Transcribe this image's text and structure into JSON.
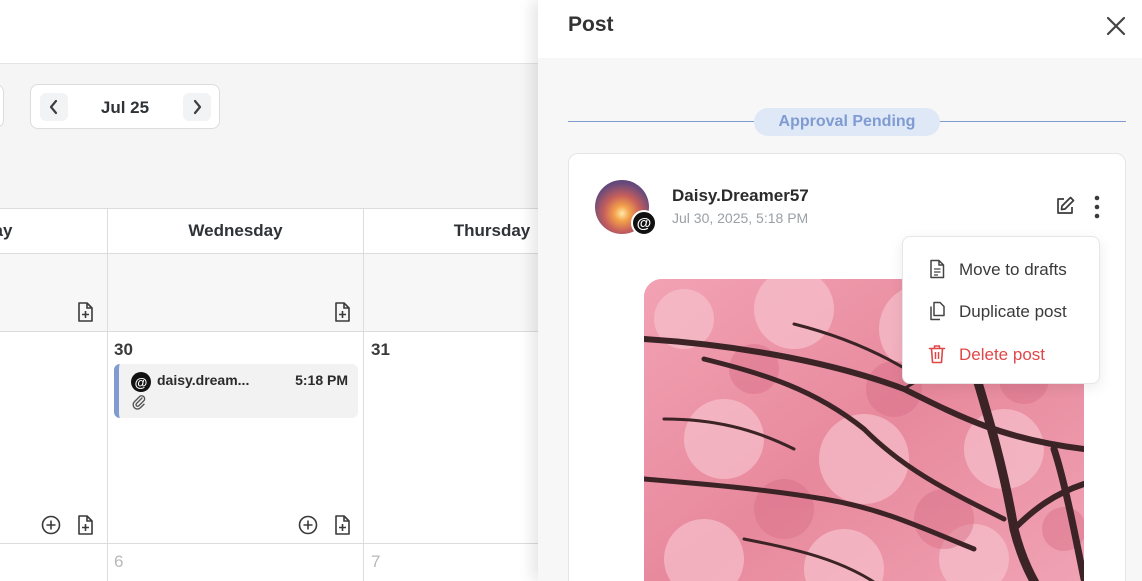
{
  "calendar": {
    "date_nav": {
      "label": "Jul 25"
    },
    "days": [
      "ay",
      "Wednesday",
      "Thursday"
    ],
    "cells": {
      "wed_date": "30",
      "thu_date": "31",
      "next_wed_date": "6",
      "next_thu_date": "7"
    },
    "event": {
      "name": "daisy.dream...",
      "time": "5:18 PM",
      "platform_icon": "threads-icon",
      "status_color": "#7f9bd1"
    }
  },
  "panel": {
    "title": "Post",
    "status": "Approval Pending",
    "post": {
      "author": "Daisy.Dreamer57",
      "date": "Jul 30, 2025, 5:18 PM",
      "platform_icon": "threads-icon"
    },
    "menu": [
      {
        "label": "Move to drafts",
        "icon": "document-icon"
      },
      {
        "label": "Duplicate post",
        "icon": "copy-icon"
      },
      {
        "label": "Delete post",
        "icon": "trash-icon",
        "color": "#e04848"
      }
    ]
  },
  "colors": {
    "accent": "#7f9bd1",
    "accent_bg": "#dfe8f6",
    "danger": "#e04848"
  }
}
